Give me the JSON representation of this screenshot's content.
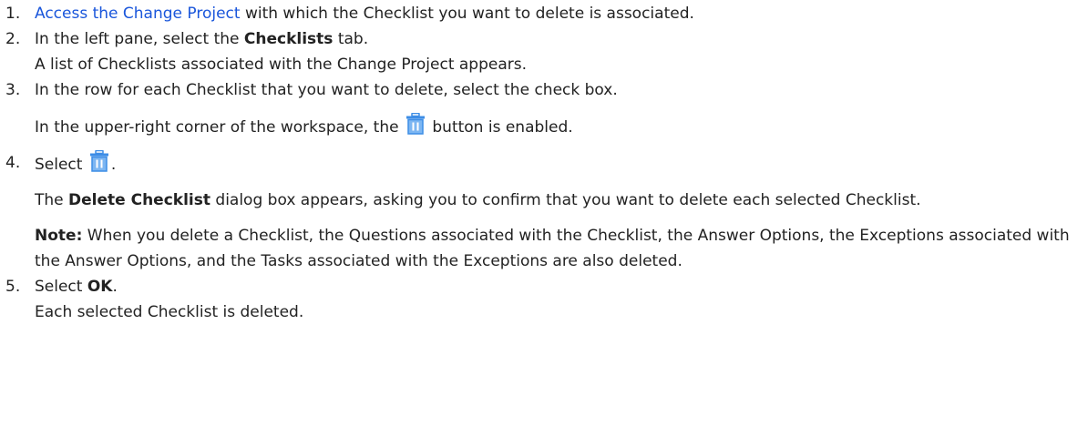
{
  "steps": [
    {
      "num": "1.",
      "link": "Access the Change Project",
      "text": " with which the Checklist you want to delete is associated."
    },
    {
      "num": "2.",
      "pre": "In the left pane, select the ",
      "bold": "Checklists",
      "post": " tab.",
      "result": "A list of Checklists associated with the Change Project appears."
    },
    {
      "num": "3.",
      "text": "In the row for each Checklist that you want to delete, select the check box.",
      "result_pre": "In the upper-right corner of the workspace, the ",
      "result_post": " button is enabled."
    },
    {
      "num": "4.",
      "pre": "Select ",
      "post": ".",
      "result_bold": "Delete Checklist",
      "result_text": " dialog box appears, asking you to confirm that you want to delete each selected Checklist.",
      "result_lead": "The ",
      "note_label": "Note:",
      "note_text": " When you delete a Checklist, the Questions associated with the Checklist, the Answer Options, the Exceptions associated with the Answer Options, and the Tasks associated with the Exceptions are also deleted."
    },
    {
      "num": "5.",
      "pre": "Select ",
      "bold": "OK",
      "post": ".",
      "result": "Each selected Checklist is deleted."
    }
  ],
  "icons": {
    "trash": "trash-icon",
    "accent": "#3d8de6",
    "accent_light": "#7cb6f2"
  },
  "colors": {
    "link": "#1a56db",
    "text": "#222222"
  }
}
